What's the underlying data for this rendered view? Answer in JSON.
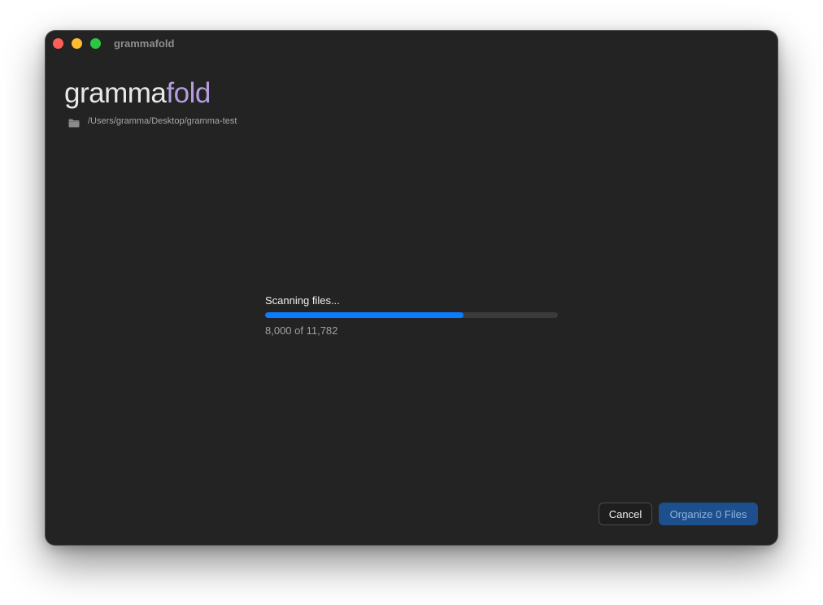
{
  "window": {
    "title": "grammafold"
  },
  "logo": {
    "part1": "gramma",
    "part2": "fold"
  },
  "folder": {
    "icon": "folder-icon",
    "path": "/Users/gramma/Desktop/gramma-test"
  },
  "progress": {
    "label": "Scanning files...",
    "count_text": "8,000 of 11,782",
    "current": 8000,
    "total": 11782,
    "fill_color": "#0a7cff"
  },
  "buttons": {
    "cancel_label": "Cancel",
    "organize_label": "Organize 0 Files"
  },
  "colors": {
    "accent": "#b49ee0",
    "primary_button": "#1d4f8c"
  }
}
